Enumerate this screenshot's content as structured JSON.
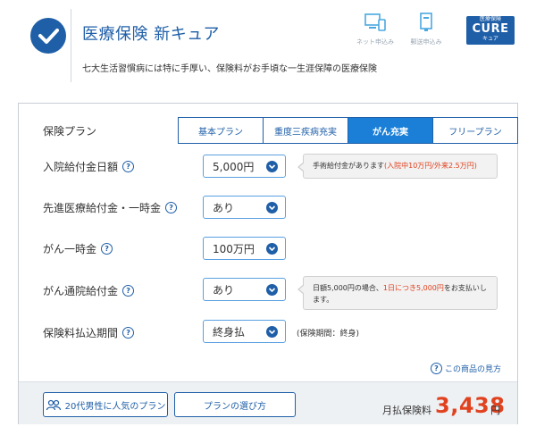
{
  "header": {
    "title": "医療保険 新キュア",
    "subtitle": "七大生活習慣病には特に手厚い、保険料がお手頃な一生涯保障の医療保険",
    "net_label": "ネット申込み",
    "mail_label": "郵送申込み",
    "logo_top": "医療保険",
    "logo_main": "CURE",
    "logo_bottom": "キュア"
  },
  "plan": {
    "label": "保険プラン",
    "tabs": [
      "基本プラン",
      "重度三疾病充実",
      "がん充実",
      "フリープラン"
    ],
    "active_tab": "がん充実"
  },
  "rows": [
    {
      "label": "入院給付金日額",
      "value": "5,000円"
    },
    {
      "label": "先進医療給付金・一時金",
      "value": "あり"
    },
    {
      "label": "がん一時金",
      "value": "100万円"
    },
    {
      "label": "がん通院給付金",
      "value": "あり"
    },
    {
      "label": "保険料払込期間",
      "value": "終身払"
    }
  ],
  "notes": {
    "hospital_pre": "手術給付金があります",
    "hospital_red": "(入院中10万円/外来2.5万円)",
    "outpatient_pre": "日額5,000円の場合、",
    "outpatient_red": "1日につき5,000円",
    "outpatient_post": "をお支払いし",
    "outpatient_line2": "ます。",
    "period": "(保険期間：終身)"
  },
  "howto_label": "この商品の見方",
  "footer": {
    "popular_button": "20代男性に人気のプラン",
    "guide_button": "プランの選び方",
    "premium_label": "月払保険料",
    "premium_value": "3,438",
    "premium_unit": "円"
  },
  "colors": {
    "brand": "#1f5fa8",
    "active_tab": "#1b7fd8",
    "price": "#e0421f"
  }
}
